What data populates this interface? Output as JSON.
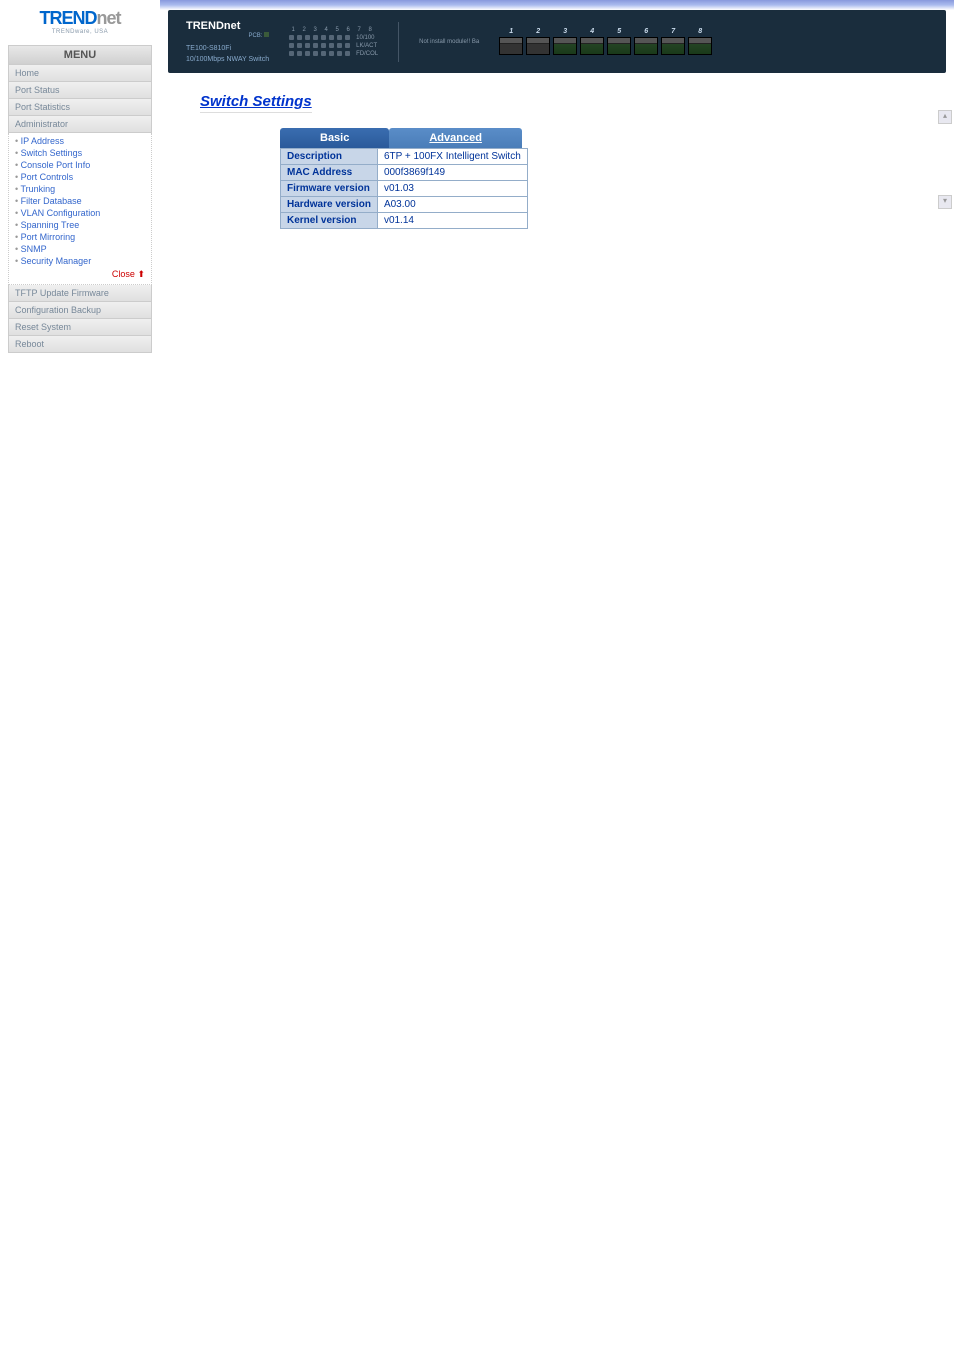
{
  "brand": {
    "name1": "TREND",
    "name2": "net",
    "tagline": "TRENDware, USA"
  },
  "menu": {
    "header": "MENU",
    "items": {
      "home": "Home",
      "port_status": "Port Status",
      "port_statistics": "Port Statistics",
      "administrator": "Administrator",
      "tftp": "TFTP Update Firmware",
      "config_backup": "Configuration Backup",
      "reset": "Reset System",
      "reboot": "Reboot"
    },
    "admin_sub": [
      "IP Address",
      "Switch Settings",
      "Console Port Info",
      "Port Controls",
      "Trunking",
      "Filter Database",
      "VLAN Configuration",
      "Spanning Tree",
      "Port Mirroring",
      "SNMP",
      "Security Manager"
    ],
    "close": "Close"
  },
  "device": {
    "logo": "TRENDnet",
    "pcb": "PCB:",
    "model1": "TE100-S810Fi",
    "model2": "10/100Mbps NWAY Switch",
    "led_labels": {
      "l1": "10/100",
      "l2": "LK/ACT",
      "l3": "FD/COL"
    },
    "hw_text": "Not install module!! Ba"
  },
  "page": {
    "title": "Switch Settings",
    "tabs": {
      "basic": "Basic",
      "advanced": "Advanced"
    },
    "table": {
      "description": {
        "label": "Description",
        "value": "6TP + 100FX Intelligent Switch"
      },
      "mac": {
        "label": "MAC Address",
        "value": "000f3869f149"
      },
      "firmware": {
        "label": "Firmware version",
        "value": "v01.03"
      },
      "hardware": {
        "label": "Hardware version",
        "value": "A03.00"
      },
      "kernel": {
        "label": "Kernel version",
        "value": "v01.14"
      }
    }
  }
}
